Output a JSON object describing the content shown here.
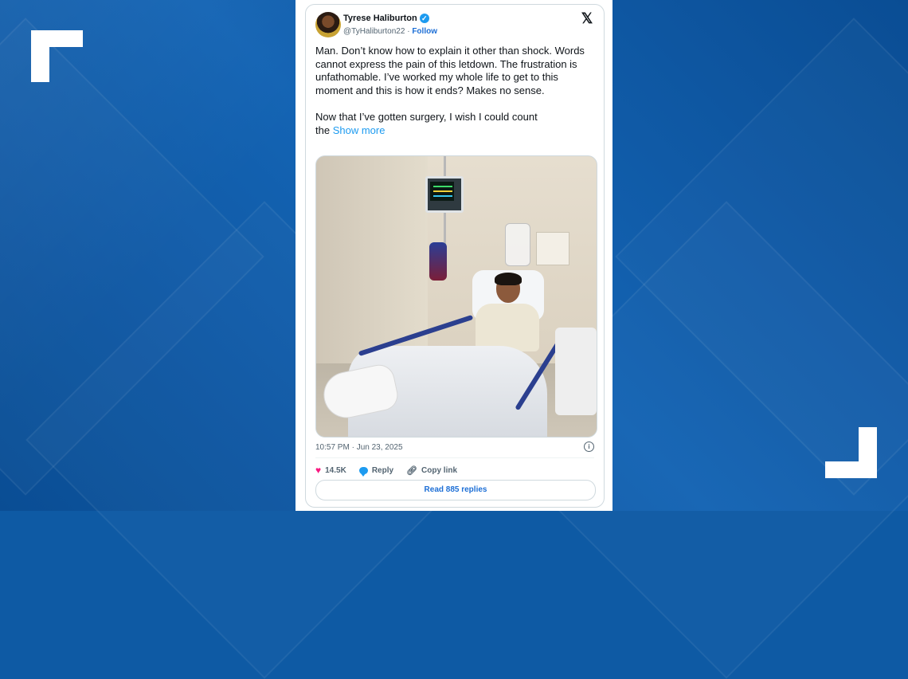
{
  "tweet": {
    "author_name": "Tyrese Haliburton",
    "handle": "@TyHaliburton22",
    "separator": "·",
    "follow_label": "Follow",
    "text": "Man. Don’t know how to explain it other than shock. Words cannot express the pain of this letdown. The frustration is unfathomable. I’ve worked my whole life to get to this moment and this is how it ends? Makes no sense.\n\nNow that I’ve gotten surgery, I wish I could count\nthe ",
    "show_more_label": "Show more",
    "timestamp": "10:57 PM · Jun 23, 2025",
    "likes_count": "14.5K",
    "reply_label": "Reply",
    "copy_link_label": "Copy link",
    "read_replies_label": "Read 885 replies"
  },
  "icons": {
    "verified": "verified-badge-icon",
    "x_logo": "x-logo-icon",
    "info": "info-icon",
    "heart": "heart-icon",
    "reply": "reply-icon",
    "link": "link-icon"
  },
  "colors": {
    "background_blue": "#0e5aa4",
    "link_blue": "#1d9bf0",
    "like_pink": "#f91880",
    "text_dark": "#0f1419",
    "text_muted": "#536471"
  }
}
